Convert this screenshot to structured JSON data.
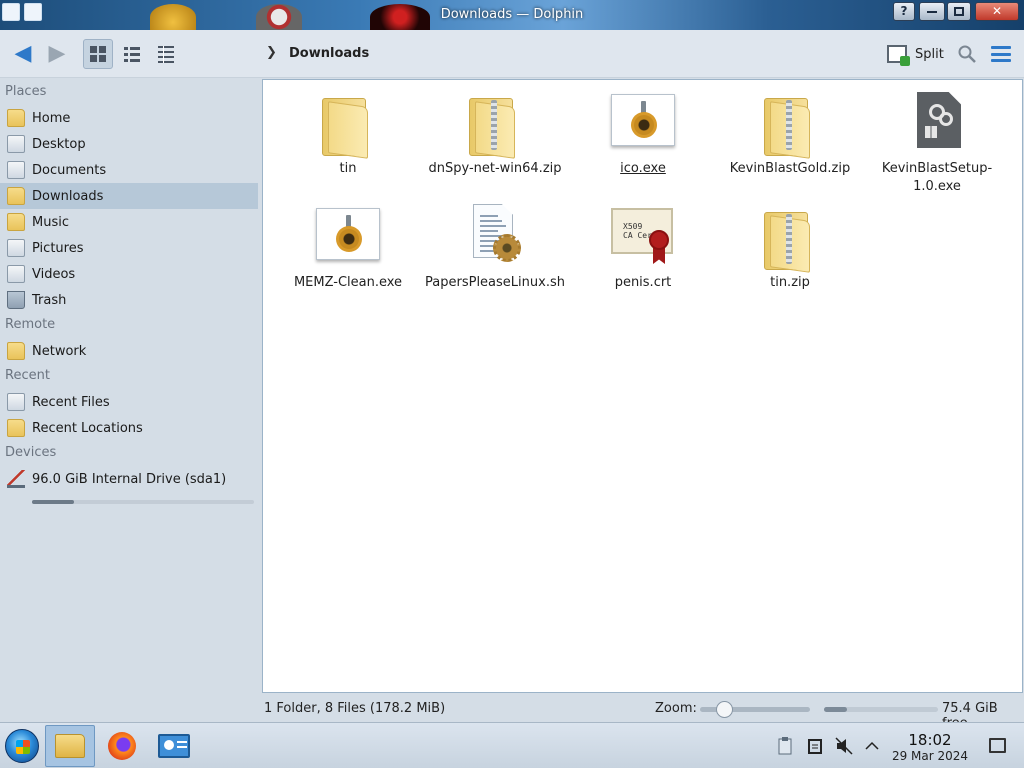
{
  "window": {
    "title": "Downloads — Dolphin",
    "help_label": "?",
    "close_label": "✕"
  },
  "toolbar": {
    "breadcrumb": "Downloads",
    "split_label": "Split"
  },
  "sidebar": {
    "sections": [
      {
        "title": "Places",
        "items": [
          {
            "label": "Home",
            "icon": "home-folder-icon"
          },
          {
            "label": "Desktop",
            "icon": "desktop-icon"
          },
          {
            "label": "Documents",
            "icon": "documents-icon"
          },
          {
            "label": "Downloads",
            "icon": "downloads-icon",
            "selected": true
          },
          {
            "label": "Music",
            "icon": "music-icon"
          },
          {
            "label": "Pictures",
            "icon": "pictures-icon"
          },
          {
            "label": "Videos",
            "icon": "videos-icon"
          },
          {
            "label": "Trash",
            "icon": "trash-icon"
          }
        ]
      },
      {
        "title": "Remote",
        "items": [
          {
            "label": "Network",
            "icon": "network-icon"
          }
        ]
      },
      {
        "title": "Recent",
        "items": [
          {
            "label": "Recent Files",
            "icon": "recent-files-icon"
          },
          {
            "label": "Recent Locations",
            "icon": "recent-locations-icon"
          }
        ]
      },
      {
        "title": "Devices",
        "items": [
          {
            "label": "96.0 GiB Internal Drive (sda1)",
            "icon": "drive-icon"
          }
        ]
      }
    ],
    "drive_usage_fraction": 0.19
  },
  "files": [
    {
      "name": "tin",
      "type": "folder"
    },
    {
      "name": "dnSpy-net-win64.zip",
      "type": "zip"
    },
    {
      "name": "ico.exe",
      "type": "exe",
      "hover": true
    },
    {
      "name": "KevinBlastGold.zip",
      "type": "zip"
    },
    {
      "name": "KevinBlastSetup-1.0.exe",
      "type": "generic-exe"
    },
    {
      "name": "MEMZ-Clean.exe",
      "type": "exe"
    },
    {
      "name": "PapersPleaseLinux.sh",
      "type": "script"
    },
    {
      "name": "penis.crt",
      "type": "cert"
    },
    {
      "name": "tin.zip",
      "type": "zip"
    }
  ],
  "cert_icon_text": "X509\nCA Cert",
  "status": {
    "info": "1 Folder, 8 Files (178.2 MiB)",
    "zoom_label": "Zoom:",
    "zoom_fraction": 0.22,
    "free_space": "75.4 GiB free",
    "free_used_fraction": 0.2
  },
  "taskbar": {
    "time": "18:02",
    "date": "29 Mar 2024"
  },
  "colors": {
    "accent": "#2e79c9",
    "selection": "#b6c8d8"
  }
}
